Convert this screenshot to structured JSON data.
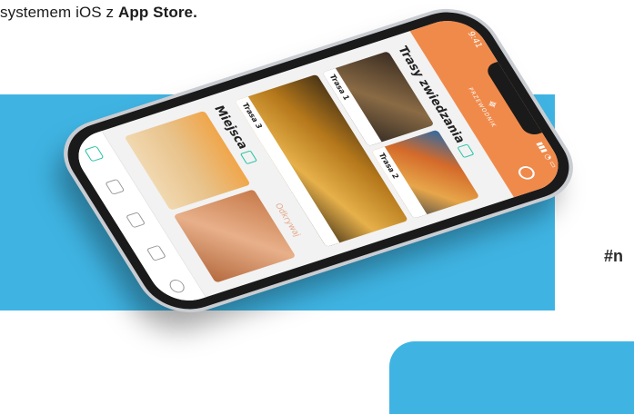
{
  "intro": {
    "prefix": "systemem iOS z ",
    "store": "App Store."
  },
  "hashtag": "#n",
  "phone": {
    "status_time": "9:41",
    "status_icons": "▮▮▮ ◔ ▭",
    "logo_name": "PRZEWODNIK",
    "section_routes_title": "Trasy zwiedzania",
    "cards": [
      {
        "label": "Trasa 1"
      },
      {
        "label": "Trasa 2"
      },
      {
        "label": "Trasa 3"
      }
    ],
    "section_places_title": "Miejsca",
    "see_all": "Odkrywaj"
  },
  "colors": {
    "accent_blue": "#3fb4e3",
    "header_orange": "#f08a4b",
    "teal": "#29c3a6"
  }
}
